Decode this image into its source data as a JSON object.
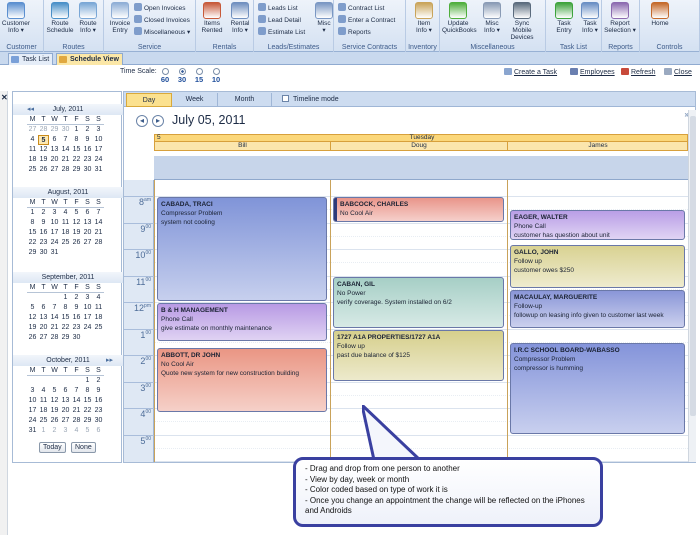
{
  "ribbon": {
    "groups": [
      {
        "name": "Customer",
        "buttons": [
          {
            "label": "Customer\nInfo ▾",
            "icon": "customer-icon",
            "color": "#5b8fd0"
          }
        ]
      },
      {
        "name": "Routes",
        "buttons": [
          {
            "label": "Route\nSchedule",
            "icon": "route-schedule-icon",
            "color": "#4a90c8"
          },
          {
            "label": "Route\nInfo ▾",
            "icon": "route-info-icon",
            "color": "#7aa7d6"
          }
        ]
      },
      {
        "name": "Service",
        "buttons": [
          {
            "label": "Invoice\nEntry",
            "icon": "invoice-entry-icon",
            "color": "#8faed6"
          }
        ],
        "small": [
          "Open Invoices",
          "Closed Invoices",
          "Miscellaneous ▾"
        ]
      },
      {
        "name": "Rentals",
        "buttons": [
          {
            "label": "Items\nRented",
            "icon": "items-rented-icon",
            "color": "#c75a3a"
          },
          {
            "label": "Rental\nInfo ▾",
            "icon": "rental-info-icon",
            "color": "#6f8fbf"
          }
        ]
      },
      {
        "name": "Leads/Estimates",
        "buttons": [
          {
            "label": "Misc\n▾",
            "icon": "misc-leads-icon",
            "color": "#7a97c3"
          }
        ],
        "small": [
          "Leads List",
          "Lead Detail",
          "Estimate List"
        ]
      },
      {
        "name": "Service Contracts",
        "small": [
          "Contract List",
          "Enter a Contract",
          "Reports"
        ]
      },
      {
        "name": "Inventory",
        "buttons": [
          {
            "label": "Item\nInfo ▾",
            "icon": "item-info-icon",
            "color": "#c9a45a"
          }
        ]
      },
      {
        "name": "Miscellaneous",
        "buttons": [
          {
            "label": "Update\nQuickBooks",
            "icon": "quickbooks-icon",
            "color": "#4fae3c"
          },
          {
            "label": "Misc\nInfo ▾",
            "icon": "misc-info-icon",
            "color": "#8a9bb5"
          },
          {
            "label": "Sync Mobile\nDevices",
            "icon": "sync-mobile-icon",
            "color": "#5b6b7d"
          }
        ]
      },
      {
        "name": "Task List",
        "buttons": [
          {
            "label": "Task\nEntry",
            "icon": "task-entry-icon",
            "color": "#3da33c"
          },
          {
            "label": "Task\nInfo ▾",
            "icon": "task-info-icon",
            "color": "#6a8fc4"
          }
        ]
      },
      {
        "name": "Reports",
        "buttons": [
          {
            "label": "Report\nSelection ▾",
            "icon": "report-selection-icon",
            "color": "#8c6bb0"
          }
        ]
      },
      {
        "name": "Controls",
        "buttons": [
          {
            "label": "Home",
            "icon": "home-icon",
            "color": "#c46a2c"
          }
        ]
      }
    ]
  },
  "doc_tabs": [
    "Task List",
    "Schedule View"
  ],
  "toolbar": {
    "time_scale_label": "Time Scale:",
    "time_scale_options": [
      "60",
      "30",
      "15",
      "10"
    ],
    "time_scale_selected": "30",
    "create_task": "Create a Task",
    "employees": "Employees",
    "refresh": "Refresh",
    "close": "Close"
  },
  "months": [
    {
      "title": "July, 2011",
      "days": [
        "27",
        "28",
        "29",
        "30",
        "1",
        "2",
        "3",
        "4",
        "5",
        "6",
        "7",
        "8",
        "9",
        "10",
        "11",
        "12",
        "13",
        "14",
        "15",
        "16",
        "17",
        "18",
        "19",
        "20",
        "21",
        "22",
        "23",
        "24",
        "25",
        "26",
        "27",
        "28",
        "29",
        "30",
        "31"
      ],
      "selected": "5"
    },
    {
      "title": "August, 2011",
      "days": [
        "1",
        "2",
        "3",
        "4",
        "5",
        "6",
        "7",
        "8",
        "9",
        "10",
        "11",
        "12",
        "13",
        "14",
        "15",
        "16",
        "17",
        "18",
        "19",
        "20",
        "21",
        "22",
        "23",
        "24",
        "25",
        "26",
        "27",
        "28",
        "29",
        "30",
        "31"
      ]
    },
    {
      "title": "September, 2011",
      "days": [
        "1",
        "2",
        "3",
        "4",
        "5",
        "6",
        "7",
        "8",
        "9",
        "10",
        "11",
        "12",
        "13",
        "14",
        "15",
        "16",
        "17",
        "18",
        "19",
        "20",
        "21",
        "22",
        "23",
        "24",
        "25",
        "26",
        "27",
        "28",
        "29",
        "30"
      ]
    },
    {
      "title": "October, 2011",
      "days": [
        "1",
        "2",
        "3",
        "4",
        "5",
        "6",
        "7",
        "8",
        "9",
        "10",
        "11",
        "12",
        "13",
        "14",
        "15",
        "16",
        "17",
        "18",
        "19",
        "20",
        "21",
        "22",
        "23",
        "24",
        "25",
        "26",
        "27",
        "28",
        "29",
        "30",
        "31",
        "1",
        "2",
        "3",
        "4",
        "5",
        "6"
      ]
    }
  ],
  "weekday_letters": [
    "M",
    "T",
    "W",
    "T",
    "F",
    "S",
    "S"
  ],
  "cal_buttons": {
    "today": "Today",
    "none": "None"
  },
  "view_tabs": [
    "Day",
    "Week",
    "Month"
  ],
  "timeline_mode": "Timeline mode",
  "date_title": "July 05, 2011",
  "day_number": "5",
  "day_name": "Tuesday",
  "resources": [
    "Bill",
    "Doug",
    "James"
  ],
  "hours": [
    "8",
    "9",
    "10",
    "11",
    "12",
    "1",
    "2",
    "3",
    "4",
    "5"
  ],
  "hour_suffix": [
    "am",
    "00",
    "00",
    "00",
    "pm",
    "00",
    "00",
    "00",
    "00",
    "00"
  ],
  "appointments": [
    {
      "col": 0,
      "start": 0,
      "end": 4,
      "name": "CABADA, TRACI",
      "lines": [
        "Compressor Problem",
        "system not cooling"
      ],
      "color": "#8094d8"
    },
    {
      "col": 0,
      "start": 4,
      "end": 5.5,
      "name": "B & H MANAGEMENT",
      "lines": [
        "Phone Call",
        "give estimate on monthly maintenance"
      ],
      "color": "#b89ae4"
    },
    {
      "col": 0,
      "start": 5.7,
      "end": 8.2,
      "name": "ABBOTT, DR JOHN",
      "lines": [
        "No Cool Air",
        "Quote new system for new construction building"
      ],
      "color": "#ea9684"
    },
    {
      "col": 1,
      "start": 0,
      "end": 1,
      "name": "BABCOCK, CHARLES",
      "lines": [
        "No Cool Air"
      ],
      "color": "#e9958a"
    },
    {
      "col": 1,
      "start": 3,
      "end": 5,
      "name": "CABAN, GIL",
      "lines": [
        "No Power",
        "verify coverage.  System installed on 6/2"
      ],
      "color": "#a6cfc6"
    },
    {
      "col": 1,
      "start": 5,
      "end": 7,
      "name": "1727 A1A PROPERTIES/1727 A1A",
      "lines": [
        "Follow up",
        "past due balance of $125"
      ],
      "color": "#d6cf8c"
    },
    {
      "col": 2,
      "start": 0.5,
      "end": 1.7,
      "name": "EAGER, WALTER",
      "lines": [
        "Phone Call",
        "customer has question about unit"
      ],
      "color": "#b99ee6"
    },
    {
      "col": 2,
      "start": 1.8,
      "end": 3.5,
      "name": "GALLO, JOHN",
      "lines": [
        "Follow up",
        "customer owes $250"
      ],
      "color": "#d9d292"
    },
    {
      "col": 2,
      "start": 3.5,
      "end": 5,
      "name": "MACAULAY, MARGUERITE",
      "lines": [
        "Follow-up",
        "followup on leasing info given to customer last week"
      ],
      "color": "#8a96d8"
    },
    {
      "col": 2,
      "start": 5.5,
      "end": 9,
      "name": "I.R.C SCHOOL BOARD-WABASSO",
      "lines": [
        "Compressor Problem",
        "compressor is humming"
      ],
      "color": "#8494da"
    }
  ],
  "callout_lines": [
    "- Drag and drop from one person to another",
    "- View by day, week or month",
    "- Color coded based on type of work it is",
    "- Once you change an appointment the change will be reflected on the iPhones and Androids"
  ]
}
